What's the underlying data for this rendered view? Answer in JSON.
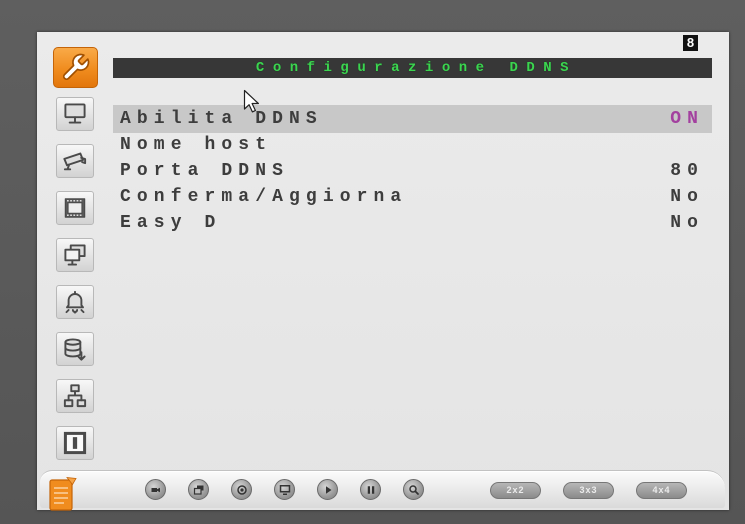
{
  "window": {
    "channel_badge": "8"
  },
  "title": "Configurazione DDNS",
  "colors": {
    "frame": "#5f5f5f",
    "panel": "#ebebeb",
    "accent": "#f08c1e",
    "title_bar": "#373737",
    "title_text": "#3cd450",
    "menu_text": "#3d3d3d",
    "selected_row": "#c8c8c8",
    "selected_value": "#a3409f"
  },
  "sidebar": {
    "items": [
      {
        "icon": "wrench-icon",
        "selected": true
      },
      {
        "icon": "monitor-icon",
        "selected": false
      },
      {
        "icon": "camera-icon",
        "selected": false
      },
      {
        "icon": "film-strip-icon",
        "selected": false
      },
      {
        "icon": "windows-icon",
        "selected": false
      },
      {
        "icon": "alarm-bell-icon",
        "selected": false
      },
      {
        "icon": "database-icon",
        "selected": false
      },
      {
        "icon": "network-icon",
        "selected": false
      },
      {
        "icon": "info-icon",
        "selected": false
      }
    ]
  },
  "menu": {
    "rows": [
      {
        "label": "Abilita DDNS",
        "value": "ON",
        "selected": true
      },
      {
        "label": "Nome host",
        "selected": false
      },
      {
        "label": "Porta DDNS",
        "value": "80",
        "selected": false
      },
      {
        "label": "Conferma/Aggiorna",
        "value": "No",
        "selected": false
      },
      {
        "label": "Easy D",
        "value": "No",
        "selected": false
      }
    ]
  },
  "toolbar": {
    "menu_icon": "main-menu-icon",
    "buttons": [
      {
        "icon": "ptz-icon"
      },
      {
        "icon": "backup-icon"
      },
      {
        "icon": "zoom-icon"
      },
      {
        "icon": "display-icon"
      },
      {
        "icon": "play-icon"
      },
      {
        "icon": "pause-icon"
      },
      {
        "icon": "search-icon"
      }
    ],
    "layouts": [
      "2x2",
      "3x3",
      "4x4"
    ]
  }
}
